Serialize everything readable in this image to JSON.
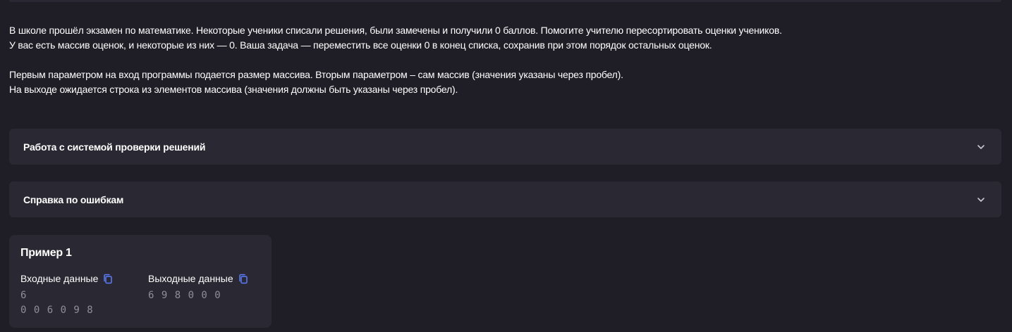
{
  "description": {
    "lines": [
      "В школе прошёл экзамен по математике. Некоторые ученики списали решения, были замечены и получили 0 баллов. Помогите учителю пересортировать оценки учеников.",
      "У вас есть массив оценок, и некоторые из них — 0. Ваша задача — переместить все оценки 0 в конец списка, сохранив при этом порядок остальных оценок.",
      "Первым параметром на вход программы подается размер массива. Вторым параметром – сам массив (значения указаны через пробел).",
      "На выходе ожидается строка из элементов массива (значения должны быть указаны через пробел)."
    ]
  },
  "accordions": [
    {
      "title": "Работа с системой проверки решений",
      "icon": "chevron-down-icon"
    },
    {
      "title": "Справка по ошибкам",
      "icon": "chevron-down-icon"
    }
  ],
  "example": {
    "title": "Пример 1",
    "input": {
      "label": "Входные данные",
      "icon": "copy-icon",
      "lines": [
        "6",
        "0 0 6 0 9 8"
      ]
    },
    "output": {
      "label": "Выходные данные",
      "icon": "copy-icon",
      "lines": [
        "6 9 8 0 0 0"
      ]
    }
  },
  "colors": {
    "background": "#1f1e26",
    "panel": "#2a2933",
    "accent": "#5b7cfa",
    "muted_text": "#8e8d99"
  }
}
